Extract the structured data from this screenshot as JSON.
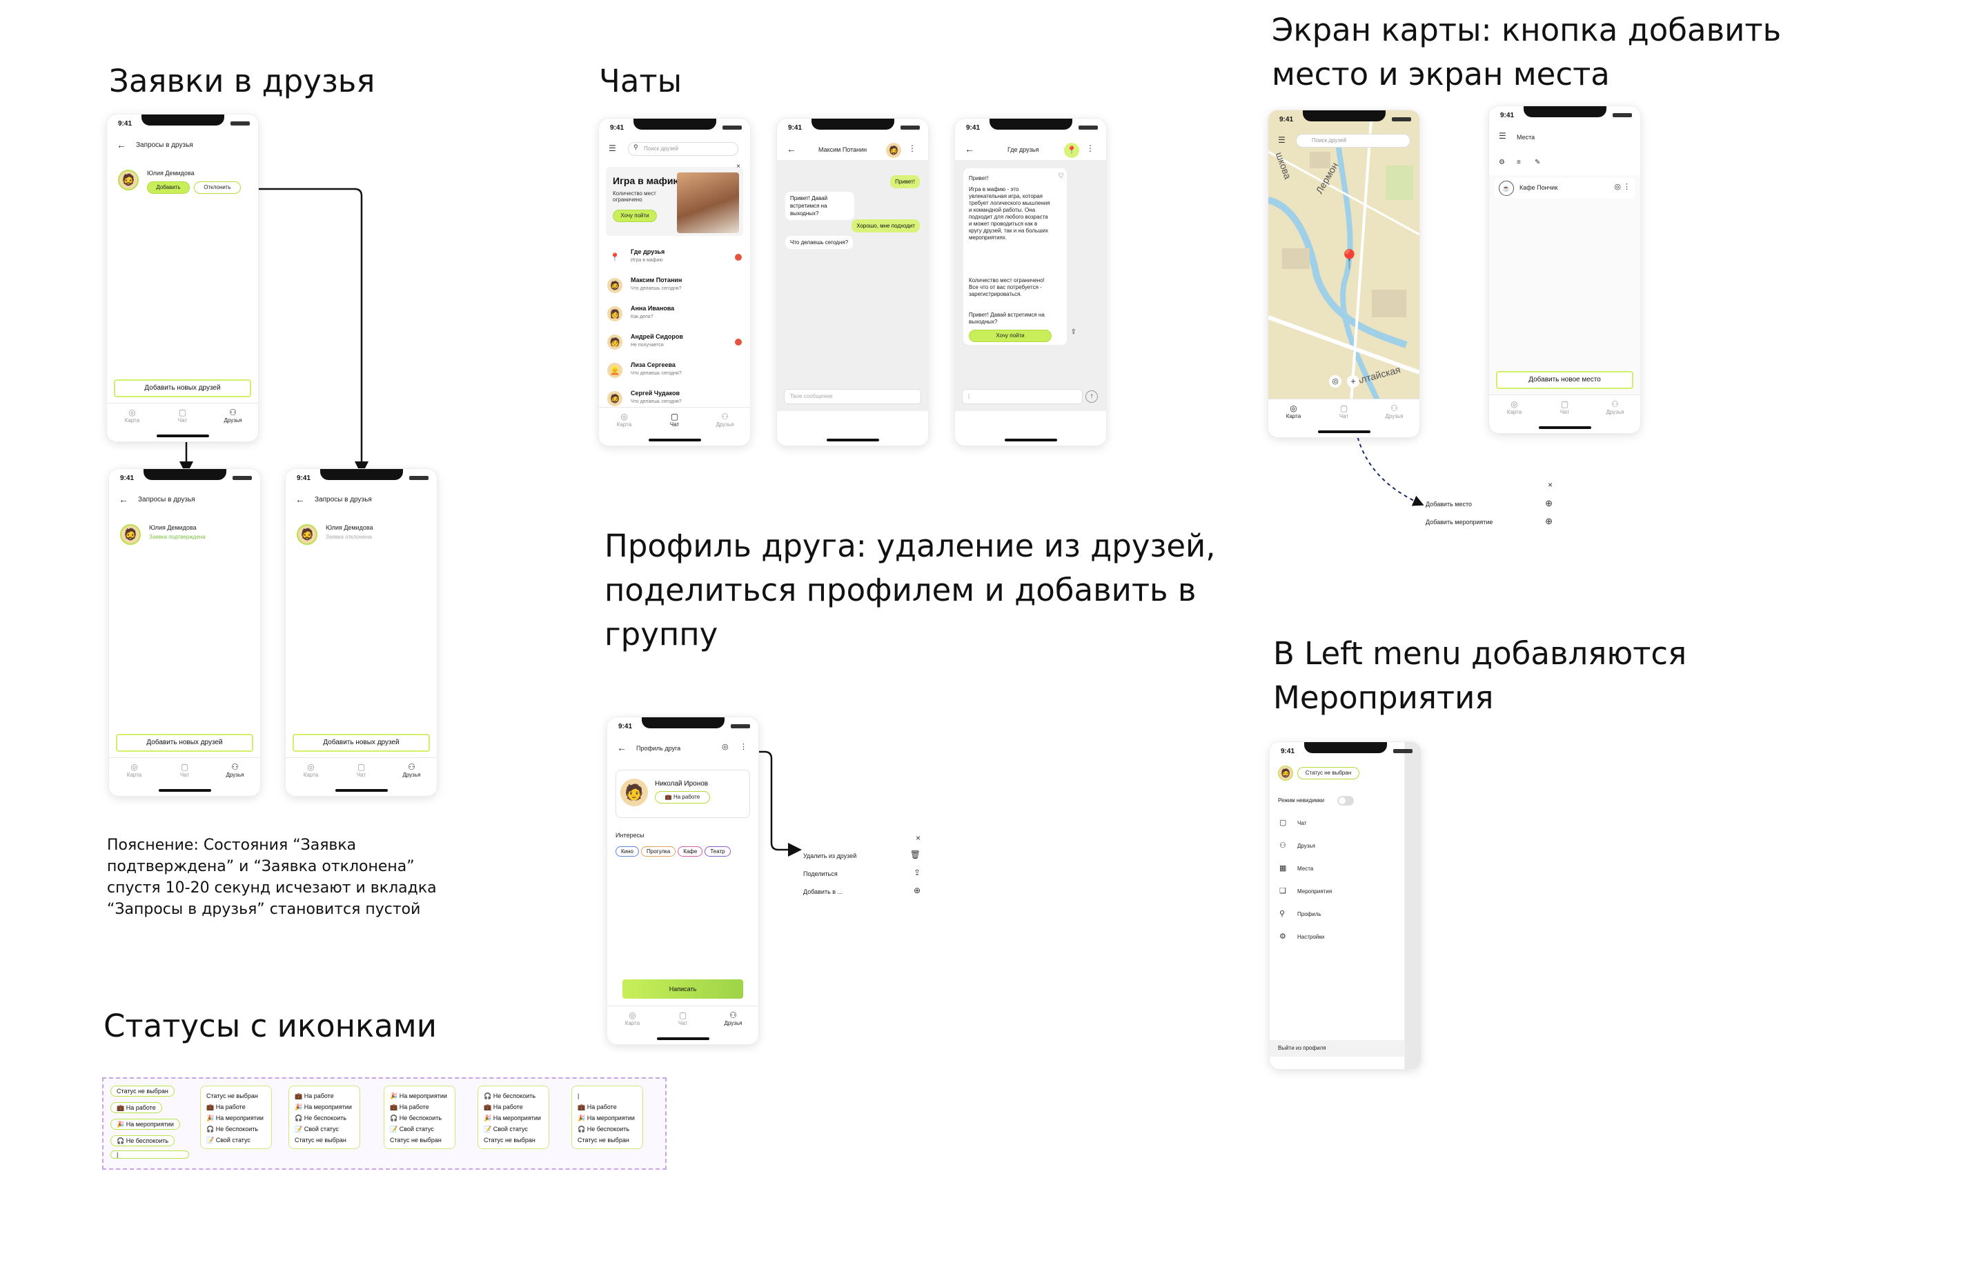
{
  "headings": {
    "friend_requests": "Заявки в друзья",
    "chats": "Чаты",
    "map": "Экран карты: кнопка добавить место и экран места",
    "friend_profile": "Профиль друга: удаление из друзей, поделиться профилем и добавить в группу",
    "left_menu": "В Left menu добавляются Мероприятия",
    "statuses": "Статусы с иконками"
  },
  "note": "Пояснение: Состояния “Заявка подтверждена” и “Заявка отклонена” спустя 10-20 секунд исчезают и вкладка “Запросы в друзья” становится пустой",
  "common": {
    "time": "9:41",
    "tabs": {
      "map": "Карта",
      "chat": "Чат",
      "friends": "Друзья"
    },
    "add_friends": "Добавить новых друзей"
  },
  "requests": {
    "title": "Запросы в друзья",
    "name": "Юлия Демидова",
    "accept": "Добавить",
    "decline": "Отклонить",
    "accepted": "Заявка подтверждена",
    "declined": "Заявка отклонена"
  },
  "chats": {
    "search_placeholder": "Поиск друзей",
    "promo": {
      "title": "Игра в мафию",
      "text": "Количество мест ограничено",
      "cta": "Хочу пойти"
    },
    "list": [
      {
        "name": "Где друзья",
        "msg": "Игра в мафию",
        "icon": "pin-icon",
        "unread": true
      },
      {
        "name": "Максим Потанин",
        "msg": "Что делаешь сегодня?",
        "icon": "avatar",
        "unread": false
      },
      {
        "name": "Анна Иванова",
        "msg": "Как дела?",
        "icon": "avatar",
        "unread": false
      },
      {
        "name": "Андрей Сидоров",
        "msg": "Не получается",
        "icon": "avatar",
        "unread": true
      },
      {
        "name": "Лиза Сергеева",
        "msg": "Что делаешь сегодня?",
        "icon": "avatar",
        "unread": false
      },
      {
        "name": "Сергей Чудаков",
        "msg": "Что делаешь сегодня?",
        "icon": "avatar",
        "unread": false
      }
    ]
  },
  "dialog": {
    "title": "Максим Потанин",
    "messages": [
      {
        "text": "Привет!",
        "out": true
      },
      {
        "text": "Привет! Давай встретимся на выходных?",
        "out": false
      },
      {
        "text": "Хорошо, мне подходит",
        "out": true
      },
      {
        "text": "Что делаешь сегодня?",
        "out": false
      }
    ],
    "input_placeholder": "Твое сообщение"
  },
  "group": {
    "title": "Где друзья",
    "greeting": "Привет!",
    "card_text": "Игра в мафию - это увлекательная игра, которая требует логического мышления и командной работы. Она подходит для любого возраста и может проводиться как в кругу друзей, так и на больших мероприятиях.",
    "card_text2": "Количество мест ограничено! Все что от вас потребуется - зарегистрироваться.",
    "card_text3": "Привет! Давай встретимся на выходных?",
    "cta": "Хочу пойти"
  },
  "map": {
    "search_placeholder": "Поиск друзей",
    "street1": "Лермон",
    "street2": "Алтайская",
    "street3": "шкова",
    "popup": {
      "add_place": "Добавить место",
      "add_event": "Добавить мероприятие"
    }
  },
  "places": {
    "title": "Места",
    "item": "Кафе Пончик",
    "add": "Добавить новое место"
  },
  "profile": {
    "title": "Профиль друга",
    "name": "Николай Иронов",
    "status": "На работе",
    "interests_label": "Интересы",
    "interests": [
      "Кино",
      "Прогулка",
      "Кафе",
      "Театр"
    ],
    "write": "Написать",
    "menu": {
      "remove": "Удалить из друзей",
      "share": "Поделиться",
      "add_to": "Добавить в ..."
    }
  },
  "left_menu": {
    "status": "Статус не выбран",
    "invisible": "Режим невидимки",
    "items": [
      "Чат",
      "Друзья",
      "Места",
      "Мероприятия",
      "Профиль",
      "Настройки"
    ],
    "logout": "Выйти из профиля"
  },
  "statuses": {
    "pills": [
      "Статус не выбран",
      "💼 На работе",
      "🎉 На мероприятии",
      "🎧 Не беспокоить"
    ],
    "groups": [
      {
        "head": "Статус не выбран",
        "items": [
          "💼 На работе",
          "🎉 На мероприятии",
          "🎧 Не беспокоить",
          "📝 Свой статус"
        ]
      },
      {
        "head": "💼 На работе",
        "items": [
          "🎉 На мероприятии",
          "🎧 Не беспокоить",
          "📝 Свой статус",
          "Статус не выбран"
        ]
      },
      {
        "head": "🎉 На мероприятии",
        "items": [
          "💼 На работе",
          "🎧 Не беспокоить",
          "📝 Свой статус",
          "Статус не выбран"
        ]
      },
      {
        "head": "🎧 Не беспокоить",
        "items": [
          "💼 На работе",
          "🎉 На мероприятии",
          "📝 Свой статус",
          "Статус не выбран"
        ]
      },
      {
        "head": "|",
        "items": [
          "💼 На работе",
          "🎉 На мероприятии",
          "🎧 Не беспокоить",
          "Статус не выбран"
        ]
      }
    ]
  },
  "colors": {
    "accent": "#c8ef5a",
    "accent_border": "#b7e34a",
    "unread": "#e5533d"
  }
}
